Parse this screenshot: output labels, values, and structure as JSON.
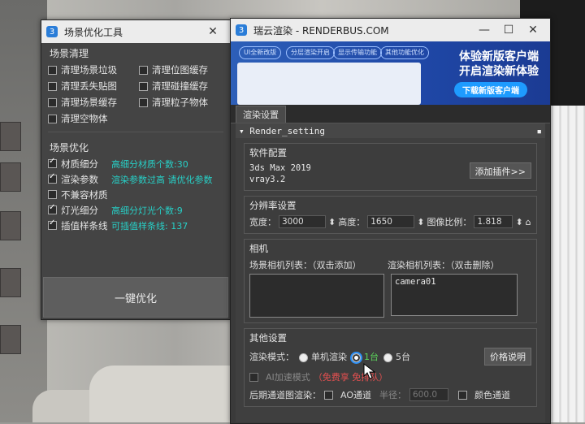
{
  "win1": {
    "title": "场景优化工具",
    "cleanup": {
      "title": "场景清理",
      "items": [
        {
          "label": "清理场景垃圾",
          "checked": false
        },
        {
          "label": "清理位图缓存",
          "checked": false
        },
        {
          "label": "清理丢失贴图",
          "checked": false
        },
        {
          "label": "清理碰撞缓存",
          "checked": false
        },
        {
          "label": "清理场景缓存",
          "checked": false
        },
        {
          "label": "清理粒子物体",
          "checked": false
        },
        {
          "label": "清理空物体",
          "checked": false
        }
      ]
    },
    "optimize": {
      "title": "场景优化",
      "items": [
        {
          "label": "材质细分",
          "checked": true,
          "note": "高细分材质个数:30"
        },
        {
          "label": "渲染参数",
          "checked": true,
          "note": "渲染参数过高 请优化参数"
        },
        {
          "label": "不兼容材质",
          "checked": false,
          "note": ""
        },
        {
          "label": "灯光细分",
          "checked": true,
          "note": "高细分灯光个数:9"
        },
        {
          "label": "插值样条线",
          "checked": true,
          "note": "可插值样条线:   137"
        }
      ]
    },
    "optimize_button": "一键优化"
  },
  "win2": {
    "title": "瑞云渲染 - RENDERBUS.COM",
    "banner": {
      "pills": [
        "UI全新改版",
        "分层渲染开启",
        "显示传输功能",
        "其他功能优化"
      ],
      "headline1": "体验新版客户端",
      "headline2": "开启渲染新体验",
      "cta": "下载新版客户端"
    },
    "tab": "渲染设置",
    "rollout_title": "Render_setting",
    "software": {
      "label": "软件配置",
      "lines": [
        "3ds Max 2019",
        "vray3.2"
      ],
      "add_plugin": "添加插件>>"
    },
    "resolution": {
      "label": "分辨率设置",
      "width_label": "宽度：",
      "width": "3000",
      "height_label": "高度：",
      "height": "1650",
      "aspect_label": "图像比例：",
      "aspect": "1.818"
    },
    "camera": {
      "label": "相机",
      "scene_list_label": "场景相机列表：（双击添加）",
      "render_list_label": "渲染相机列表：（双击删除）",
      "render_cameras": [
        "camera01"
      ]
    },
    "other": {
      "label": "其他设置",
      "mode_label": "渲染模式：",
      "modes": [
        "单机渲染",
        "1台",
        "5台"
      ],
      "selected_mode": "1台",
      "price_button": "价格说明",
      "ai_label": "AI加速模式",
      "ai_note": "（免费享  免排队）",
      "post_label": "后期通道图渲染：",
      "ao_label": "AO通道",
      "radius_label": "半径：",
      "radius": "600.0",
      "color_label": "颜色通道"
    }
  }
}
